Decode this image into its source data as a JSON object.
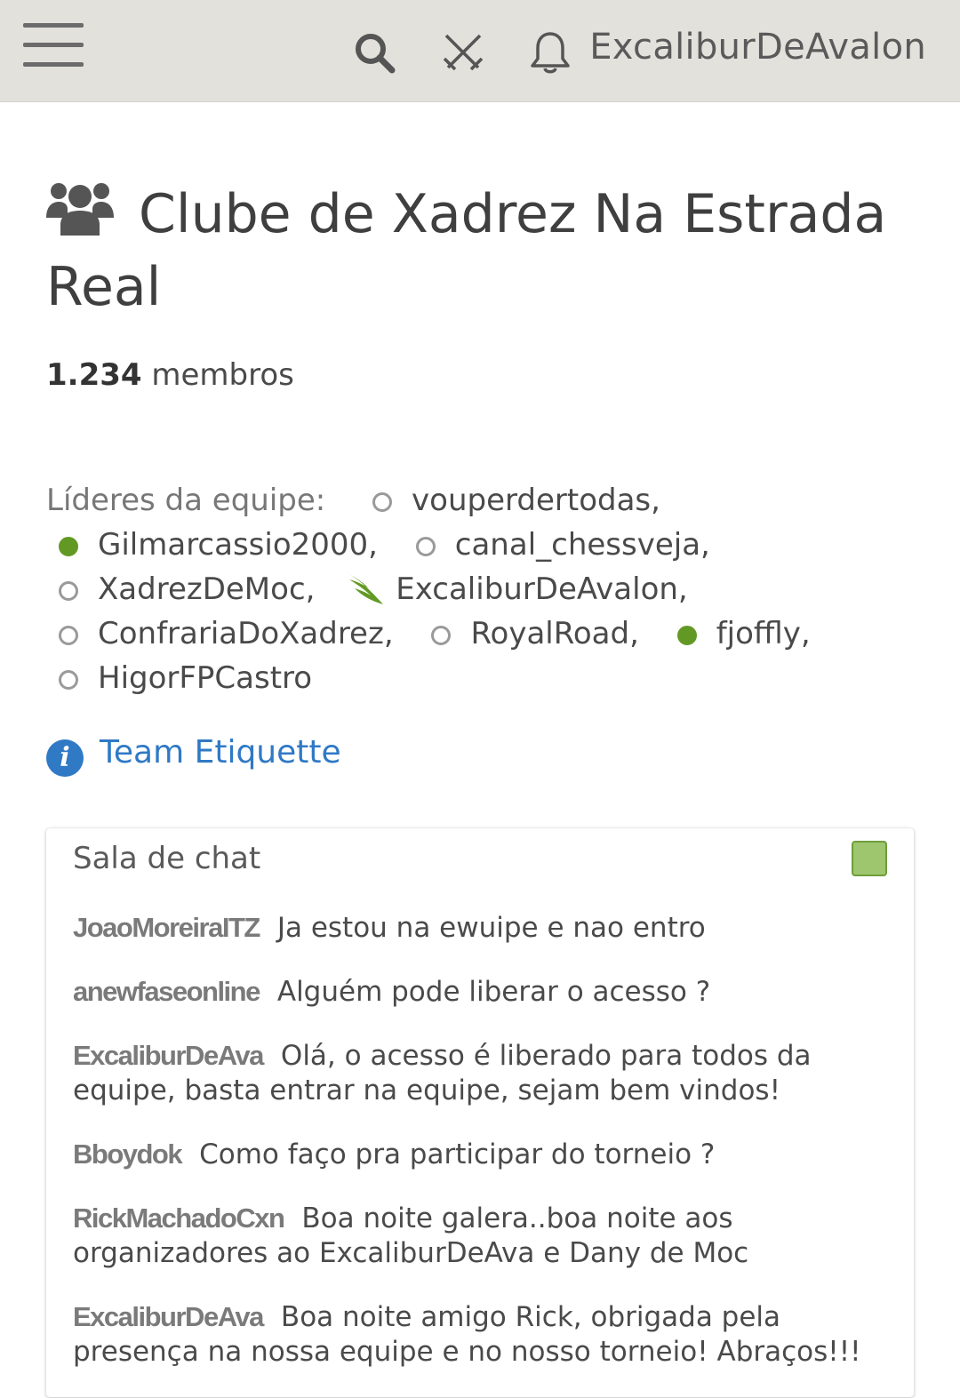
{
  "header": {
    "menu_icon": "hamburger-menu-icon",
    "search_icon": "search-icon",
    "play_icon": "crossed-swords-icon",
    "notifications_icon": "bell-icon",
    "username": "ExcaliburDeAvalon"
  },
  "team": {
    "icon": "group-icon",
    "name": "Clube de Xadrez Na Estrada Real",
    "members_count": "1.234",
    "members_label": " membros"
  },
  "leaders": {
    "label": "Líderes da equipe:",
    "items": [
      {
        "name": "vouperdertodas,",
        "status": "offline"
      },
      {
        "name": "Gilmarcassio2000,",
        "status": "online"
      },
      {
        "name": "canal_chessveja,",
        "status": "offline"
      },
      {
        "name": "XadrezDeMoc,",
        "status": "offline"
      },
      {
        "name": "ExcaliburDeAvalon,",
        "status": "patron"
      },
      {
        "name": "ConfrariaDoXadrez,",
        "status": "offline"
      },
      {
        "name": "RoyalRoad,",
        "status": "offline"
      },
      {
        "name": "fjoffly,",
        "status": "online"
      },
      {
        "name": "HigorFPCastro",
        "status": "offline"
      }
    ]
  },
  "etiquette": {
    "icon": "info-icon",
    "label": "Team Etiquette"
  },
  "chat": {
    "title": "Sala de chat",
    "toggle_color": "#9ec66f",
    "messages": [
      {
        "user": "JoaoMoreiraITZ",
        "text": "Ja estou na ewuipe e nao entro"
      },
      {
        "user": "anewfaseonline",
        "text": "Alguém pode liberar o acesso ?"
      },
      {
        "user": "ExcaliburDeAva",
        "text": "Olá, o acesso é liberado para todos da equipe, basta entrar na equipe, sejam bem vindos!"
      },
      {
        "user": "Bboydok",
        "text": "Como faço pra participar do torneio ?"
      },
      {
        "user": "RickMachadoCxn",
        "text": "Boa noite galera..boa noite aos organizadores ao ExcaliburDeAva e Dany de Moc"
      },
      {
        "user": "ExcaliburDeAva",
        "text": "Boa noite amigo Rick, obrigada pela presença na nossa equipe e no nosso torneio! Abraços!!!"
      }
    ]
  }
}
